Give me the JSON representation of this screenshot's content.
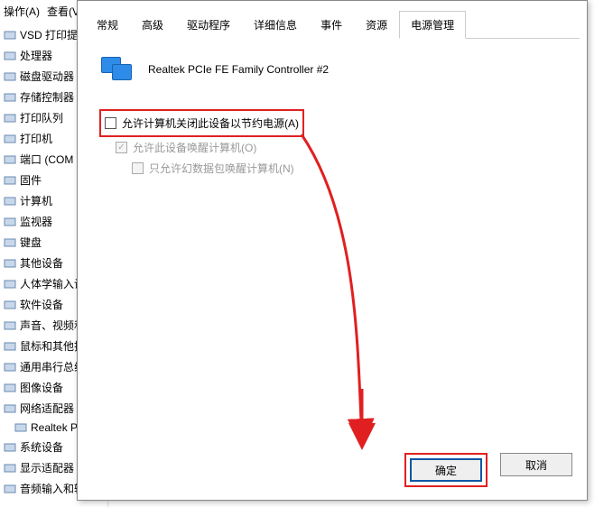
{
  "bg_menu": {
    "op": "操作(A)",
    "view": "查看(V"
  },
  "tree": [
    "VSD 打印提供程",
    "处理器",
    "磁盘驱动器",
    "存储控制器",
    "打印队列",
    "打印机",
    "端口 (COM 和 LP",
    "固件",
    "计算机",
    "监视器",
    "键盘",
    "其他设备",
    "人体学输入设备",
    "软件设备",
    "声音、视频和游戏",
    "鼠标和其他指针设",
    "通用串行总线控制",
    "图像设备",
    "网络适配器",
    "Realtek PCIe",
    "系统设备",
    "显示适配器",
    "音频输入和输出"
  ],
  "tabs": {
    "general": "常规",
    "advanced": "高级",
    "driver": "驱动程序",
    "details": "详细信息",
    "events": "事件",
    "resources": "资源",
    "power": "电源管理"
  },
  "device_title": "Realtek PCIe FE Family Controller #2",
  "checkboxes": {
    "allow_off": "允许计算机关闭此设备以节约电源(A)",
    "allow_wake": "允许此设备唤醒计算机(O)",
    "magic_only": "只允许幻数据包唤醒计算机(N)"
  },
  "buttons": {
    "ok": "确定",
    "cancel": "取消"
  }
}
